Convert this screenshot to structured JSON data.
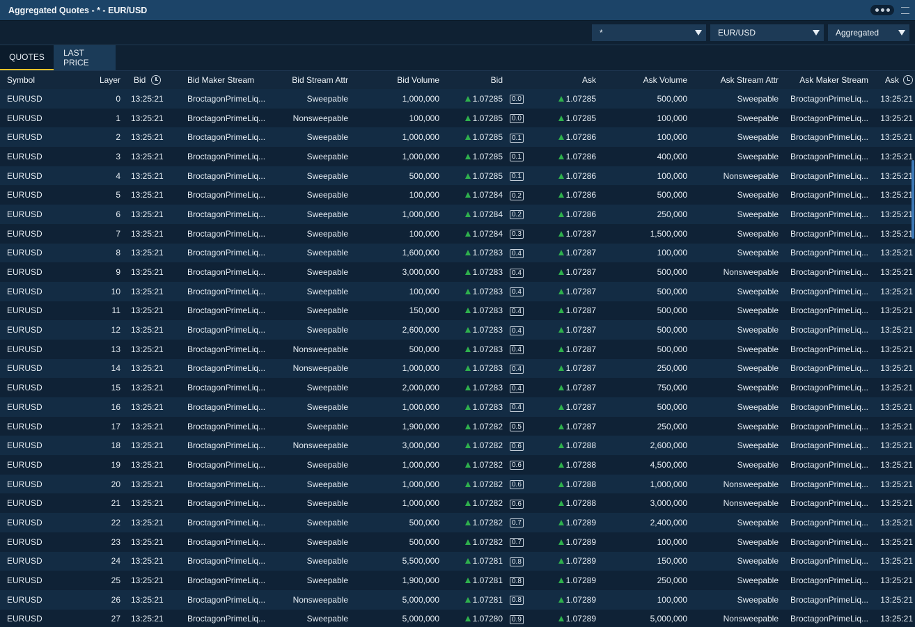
{
  "window": {
    "title": "Aggregated Quotes - * - EUR/USD"
  },
  "filters": {
    "stream": "*",
    "symbol": "EUR/USD",
    "mode": "Aggregated"
  },
  "tabs": [
    "QUOTES",
    "LAST PRICE"
  ],
  "columns": {
    "symbol": "Symbol",
    "layer": "Layer",
    "bid_time": "Bid",
    "bid_maker_stream": "Bid Maker Stream",
    "bid_stream_attr": "Bid Stream Attr",
    "bid_volume": "Bid Volume",
    "bid": "Bid",
    "ask": "Ask",
    "ask_volume": "Ask Volume",
    "ask_stream_attr": "Ask Stream Attr",
    "ask_maker_stream": "Ask Maker Stream",
    "ask_time": "Ask"
  },
  "rows": [
    [
      "EURUSD",
      "0",
      "13:25:21",
      "BroctagonPrimeLiq...",
      "Sweepable",
      "1,000,000",
      "1.07285",
      "0.0",
      "1.07285",
      "500,000",
      "Sweepable",
      "BroctagonPrimeLiq...",
      "13:25:21"
    ],
    [
      "EURUSD",
      "1",
      "13:25:21",
      "BroctagonPrimeLiq...",
      "Nonsweepable",
      "100,000",
      "1.07285",
      "0.0",
      "1.07285",
      "100,000",
      "Sweepable",
      "BroctagonPrimeLiq...",
      "13:25:21"
    ],
    [
      "EURUSD",
      "2",
      "13:25:21",
      "BroctagonPrimeLiq...",
      "Sweepable",
      "1,000,000",
      "1.07285",
      "0.1",
      "1.07286",
      "100,000",
      "Sweepable",
      "BroctagonPrimeLiq...",
      "13:25:21"
    ],
    [
      "EURUSD",
      "3",
      "13:25:21",
      "BroctagonPrimeLiq...",
      "Sweepable",
      "1,000,000",
      "1.07285",
      "0.1",
      "1.07286",
      "400,000",
      "Sweepable",
      "BroctagonPrimeLiq...",
      "13:25:21"
    ],
    [
      "EURUSD",
      "4",
      "13:25:21",
      "BroctagonPrimeLiq...",
      "Sweepable",
      "500,000",
      "1.07285",
      "0.1",
      "1.07286",
      "100,000",
      "Nonsweepable",
      "BroctagonPrimeLiq...",
      "13:25:21"
    ],
    [
      "EURUSD",
      "5",
      "13:25:21",
      "BroctagonPrimeLiq...",
      "Sweepable",
      "100,000",
      "1.07284",
      "0.2",
      "1.07286",
      "500,000",
      "Sweepable",
      "BroctagonPrimeLiq...",
      "13:25:21"
    ],
    [
      "EURUSD",
      "6",
      "13:25:21",
      "BroctagonPrimeLiq...",
      "Sweepable",
      "1,000,000",
      "1.07284",
      "0.2",
      "1.07286",
      "250,000",
      "Sweepable",
      "BroctagonPrimeLiq...",
      "13:25:21"
    ],
    [
      "EURUSD",
      "7",
      "13:25:21",
      "BroctagonPrimeLiq...",
      "Sweepable",
      "100,000",
      "1.07284",
      "0.3",
      "1.07287",
      "1,500,000",
      "Sweepable",
      "BroctagonPrimeLiq...",
      "13:25:21"
    ],
    [
      "EURUSD",
      "8",
      "13:25:21",
      "BroctagonPrimeLiq...",
      "Sweepable",
      "1,600,000",
      "1.07283",
      "0.4",
      "1.07287",
      "100,000",
      "Sweepable",
      "BroctagonPrimeLiq...",
      "13:25:21"
    ],
    [
      "EURUSD",
      "9",
      "13:25:21",
      "BroctagonPrimeLiq...",
      "Sweepable",
      "3,000,000",
      "1.07283",
      "0.4",
      "1.07287",
      "500,000",
      "Nonsweepable",
      "BroctagonPrimeLiq...",
      "13:25:21"
    ],
    [
      "EURUSD",
      "10",
      "13:25:21",
      "BroctagonPrimeLiq...",
      "Sweepable",
      "100,000",
      "1.07283",
      "0.4",
      "1.07287",
      "500,000",
      "Sweepable",
      "BroctagonPrimeLiq...",
      "13:25:21"
    ],
    [
      "EURUSD",
      "11",
      "13:25:21",
      "BroctagonPrimeLiq...",
      "Sweepable",
      "150,000",
      "1.07283",
      "0.4",
      "1.07287",
      "500,000",
      "Sweepable",
      "BroctagonPrimeLiq...",
      "13:25:21"
    ],
    [
      "EURUSD",
      "12",
      "13:25:21",
      "BroctagonPrimeLiq...",
      "Sweepable",
      "2,600,000",
      "1.07283",
      "0.4",
      "1.07287",
      "500,000",
      "Sweepable",
      "BroctagonPrimeLiq...",
      "13:25:21"
    ],
    [
      "EURUSD",
      "13",
      "13:25:21",
      "BroctagonPrimeLiq...",
      "Nonsweepable",
      "500,000",
      "1.07283",
      "0.4",
      "1.07287",
      "500,000",
      "Sweepable",
      "BroctagonPrimeLiq...",
      "13:25:21"
    ],
    [
      "EURUSD",
      "14",
      "13:25:21",
      "BroctagonPrimeLiq...",
      "Nonsweepable",
      "1,000,000",
      "1.07283",
      "0.4",
      "1.07287",
      "250,000",
      "Sweepable",
      "BroctagonPrimeLiq...",
      "13:25:21"
    ],
    [
      "EURUSD",
      "15",
      "13:25:21",
      "BroctagonPrimeLiq...",
      "Sweepable",
      "2,000,000",
      "1.07283",
      "0.4",
      "1.07287",
      "750,000",
      "Sweepable",
      "BroctagonPrimeLiq...",
      "13:25:21"
    ],
    [
      "EURUSD",
      "16",
      "13:25:21",
      "BroctagonPrimeLiq...",
      "Sweepable",
      "1,000,000",
      "1.07283",
      "0.4",
      "1.07287",
      "500,000",
      "Sweepable",
      "BroctagonPrimeLiq...",
      "13:25:21"
    ],
    [
      "EURUSD",
      "17",
      "13:25:21",
      "BroctagonPrimeLiq...",
      "Sweepable",
      "1,900,000",
      "1.07282",
      "0.5",
      "1.07287",
      "250,000",
      "Sweepable",
      "BroctagonPrimeLiq...",
      "13:25:21"
    ],
    [
      "EURUSD",
      "18",
      "13:25:21",
      "BroctagonPrimeLiq...",
      "Nonsweepable",
      "3,000,000",
      "1.07282",
      "0.6",
      "1.07288",
      "2,600,000",
      "Sweepable",
      "BroctagonPrimeLiq...",
      "13:25:21"
    ],
    [
      "EURUSD",
      "19",
      "13:25:21",
      "BroctagonPrimeLiq...",
      "Sweepable",
      "1,000,000",
      "1.07282",
      "0.6",
      "1.07288",
      "4,500,000",
      "Sweepable",
      "BroctagonPrimeLiq...",
      "13:25:21"
    ],
    [
      "EURUSD",
      "20",
      "13:25:21",
      "BroctagonPrimeLiq...",
      "Sweepable",
      "1,000,000",
      "1.07282",
      "0.6",
      "1.07288",
      "1,000,000",
      "Nonsweepable",
      "BroctagonPrimeLiq...",
      "13:25:21"
    ],
    [
      "EURUSD",
      "21",
      "13:25:21",
      "BroctagonPrimeLiq...",
      "Sweepable",
      "1,000,000",
      "1.07282",
      "0.6",
      "1.07288",
      "3,000,000",
      "Nonsweepable",
      "BroctagonPrimeLiq...",
      "13:25:21"
    ],
    [
      "EURUSD",
      "22",
      "13:25:21",
      "BroctagonPrimeLiq...",
      "Sweepable",
      "500,000",
      "1.07282",
      "0.7",
      "1.07289",
      "2,400,000",
      "Sweepable",
      "BroctagonPrimeLiq...",
      "13:25:21"
    ],
    [
      "EURUSD",
      "23",
      "13:25:21",
      "BroctagonPrimeLiq...",
      "Sweepable",
      "500,000",
      "1.07282",
      "0.7",
      "1.07289",
      "100,000",
      "Sweepable",
      "BroctagonPrimeLiq...",
      "13:25:21"
    ],
    [
      "EURUSD",
      "24",
      "13:25:21",
      "BroctagonPrimeLiq...",
      "Sweepable",
      "5,500,000",
      "1.07281",
      "0.8",
      "1.07289",
      "150,000",
      "Sweepable",
      "BroctagonPrimeLiq...",
      "13:25:21"
    ],
    [
      "EURUSD",
      "25",
      "13:25:21",
      "BroctagonPrimeLiq...",
      "Sweepable",
      "1,900,000",
      "1.07281",
      "0.8",
      "1.07289",
      "250,000",
      "Sweepable",
      "BroctagonPrimeLiq...",
      "13:25:21"
    ],
    [
      "EURUSD",
      "26",
      "13:25:21",
      "BroctagonPrimeLiq...",
      "Nonsweepable",
      "5,000,000",
      "1.07281",
      "0.8",
      "1.07289",
      "100,000",
      "Sweepable",
      "BroctagonPrimeLiq...",
      "13:25:21"
    ],
    [
      "EURUSD",
      "27",
      "13:25:21",
      "BroctagonPrimeLiq...",
      "Sweepable",
      "5,000,000",
      "1.07280",
      "0.9",
      "1.07289",
      "5,000,000",
      "Nonsweepable",
      "BroctagonPrimeLiq...",
      "13:25:21"
    ]
  ],
  "colors": {
    "uptick": "#2fb14d",
    "active_tab_underline": "#e6c229",
    "scrollbar": "#3d78b5"
  },
  "icons": {
    "uptick": "triangle-up-icon",
    "clock": "clock-icon",
    "more": "more-icon",
    "menu": "menu-icon",
    "dropdown": "caret-down-icon"
  }
}
